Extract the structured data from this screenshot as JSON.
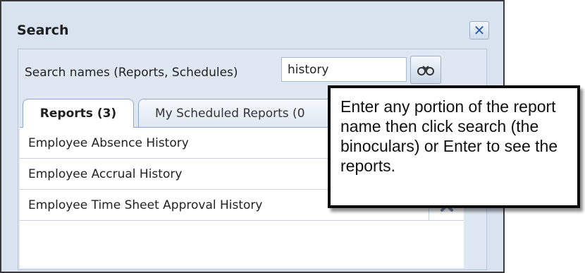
{
  "dialog": {
    "title": "Search",
    "close_icon": "close-icon"
  },
  "search": {
    "label": "Search names (Reports, Schedules)",
    "value": "history",
    "button_icon": "binoculars-icon"
  },
  "tabs": [
    {
      "label": "Reports (3)",
      "active": true
    },
    {
      "label": "My Scheduled Reports (0",
      "active": false
    }
  ],
  "reports": [
    {
      "name": "Employee Absence History"
    },
    {
      "name": "Employee Accrual History"
    },
    {
      "name": "Employee Time Sheet Approval History"
    }
  ],
  "tooltip": {
    "text": "Enter any portion of the report name then click search (the binoculars) or Enter to see the reports."
  },
  "colors": {
    "dialog_bg": "#d8e3ef",
    "accent": "#2f5fa0"
  }
}
